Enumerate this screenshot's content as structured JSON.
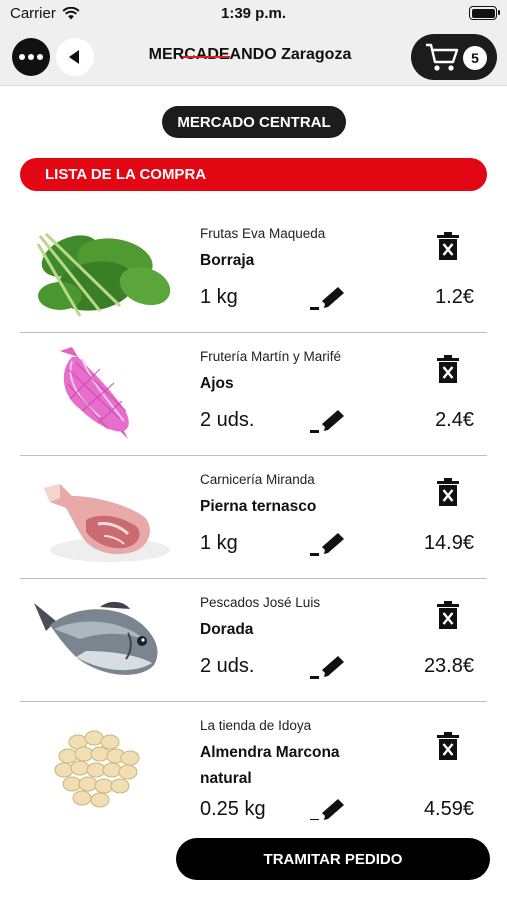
{
  "status_bar": {
    "carrier": "Carrier",
    "time": "1:39 p.m."
  },
  "header": {
    "title": "MERCADEANDO Zaragoza",
    "cart_count": "5"
  },
  "market": {
    "name": "MERCADO CENTRAL"
  },
  "list": {
    "title": "LISTA DE LA COMPRA"
  },
  "items": [
    {
      "vendor": "Frutas Eva Maqueda",
      "product": "Borraja",
      "quantity": "1 kg",
      "price": "1.2€",
      "image": "borage-image"
    },
    {
      "vendor": "Frutería Martín y Marifé",
      "product": "Ajos",
      "quantity": "2 uds.",
      "price": "2.4€",
      "image": "garlic-net-image"
    },
    {
      "vendor": "Carnicería Miranda",
      "product": "Pierna ternasco",
      "quantity": "1 kg",
      "price": "14.9€",
      "image": "lamb-leg-image"
    },
    {
      "vendor": "Pescados José Luis",
      "product": "Dorada",
      "quantity": "2 uds.",
      "price": "23.8€",
      "image": "sea-bream-image"
    },
    {
      "vendor": "La tienda de Idoya",
      "product": "Almendra Marcona natural",
      "quantity": "0.25 kg",
      "price": "4.59€",
      "image": "marcona-almonds-image"
    }
  ],
  "footer": {
    "checkout_label": "TRAMITAR PEDIDO"
  },
  "colors": {
    "accent_red": "#e30613",
    "dark": "#1c1c1c",
    "bar_bg": "#efefef"
  }
}
